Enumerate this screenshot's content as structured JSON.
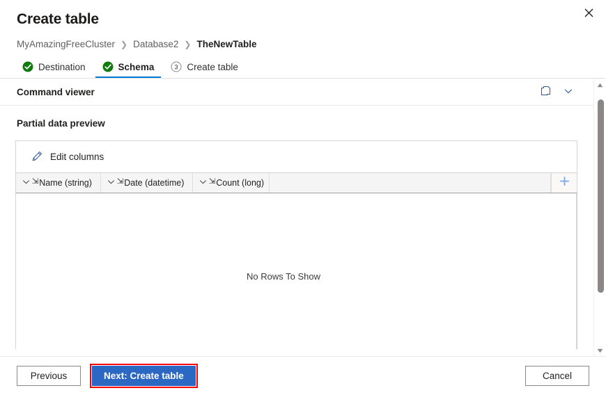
{
  "dialog": {
    "title": "Create table",
    "close_label": "✕",
    "close_icon": "close-icon"
  },
  "breadcrumb": {
    "separator": "❯",
    "items": [
      {
        "label": "MyAmazingFreeCluster",
        "current": false
      },
      {
        "label": "Database2",
        "current": false
      },
      {
        "label": "TheNewTable",
        "current": true
      }
    ]
  },
  "wizard": {
    "tabs": [
      {
        "label": "Destination",
        "state": "complete",
        "icon": "check-circle-icon",
        "active": false
      },
      {
        "label": "Schema",
        "state": "complete",
        "icon": "check-circle-icon",
        "active": true
      },
      {
        "label": "Create table",
        "state": "pending",
        "icon": "step-number-icon",
        "step": "3",
        "active": false
      }
    ]
  },
  "command_viewer": {
    "title": "Command viewer",
    "copy_icon": "copy-icon",
    "expand_icon": "chevron-down-icon"
  },
  "preview": {
    "title": "Partial data preview",
    "edit_columns_label": "Edit columns",
    "edit_columns_icon": "pencil-icon",
    "add_column_icon": "plus-icon",
    "empty_message": "No Rows To Show",
    "columns": [
      {
        "label": "Name (string)",
        "menu_icon": "chevron-down-icon",
        "type_glyph": "⇲"
      },
      {
        "label": "Date (datetime)",
        "menu_icon": "chevron-down-icon",
        "type_glyph": "⇲"
      },
      {
        "label": "Count (long)",
        "menu_icon": "chevron-down-icon",
        "type_glyph": "⇲"
      }
    ]
  },
  "scrollbar": {
    "up_icon": "triangle-up-icon",
    "down_icon": "triangle-down-icon",
    "thumb": "scrollbar-thumb"
  },
  "footer": {
    "previous_label": "Previous",
    "next_label": "Next: Create table",
    "cancel_label": "Cancel"
  },
  "colors": {
    "accent": "#0078d4",
    "primary_button": "#2b68c4",
    "success": "#107c10",
    "highlight": "#ff0000",
    "icon_blue": "#2b579a"
  }
}
